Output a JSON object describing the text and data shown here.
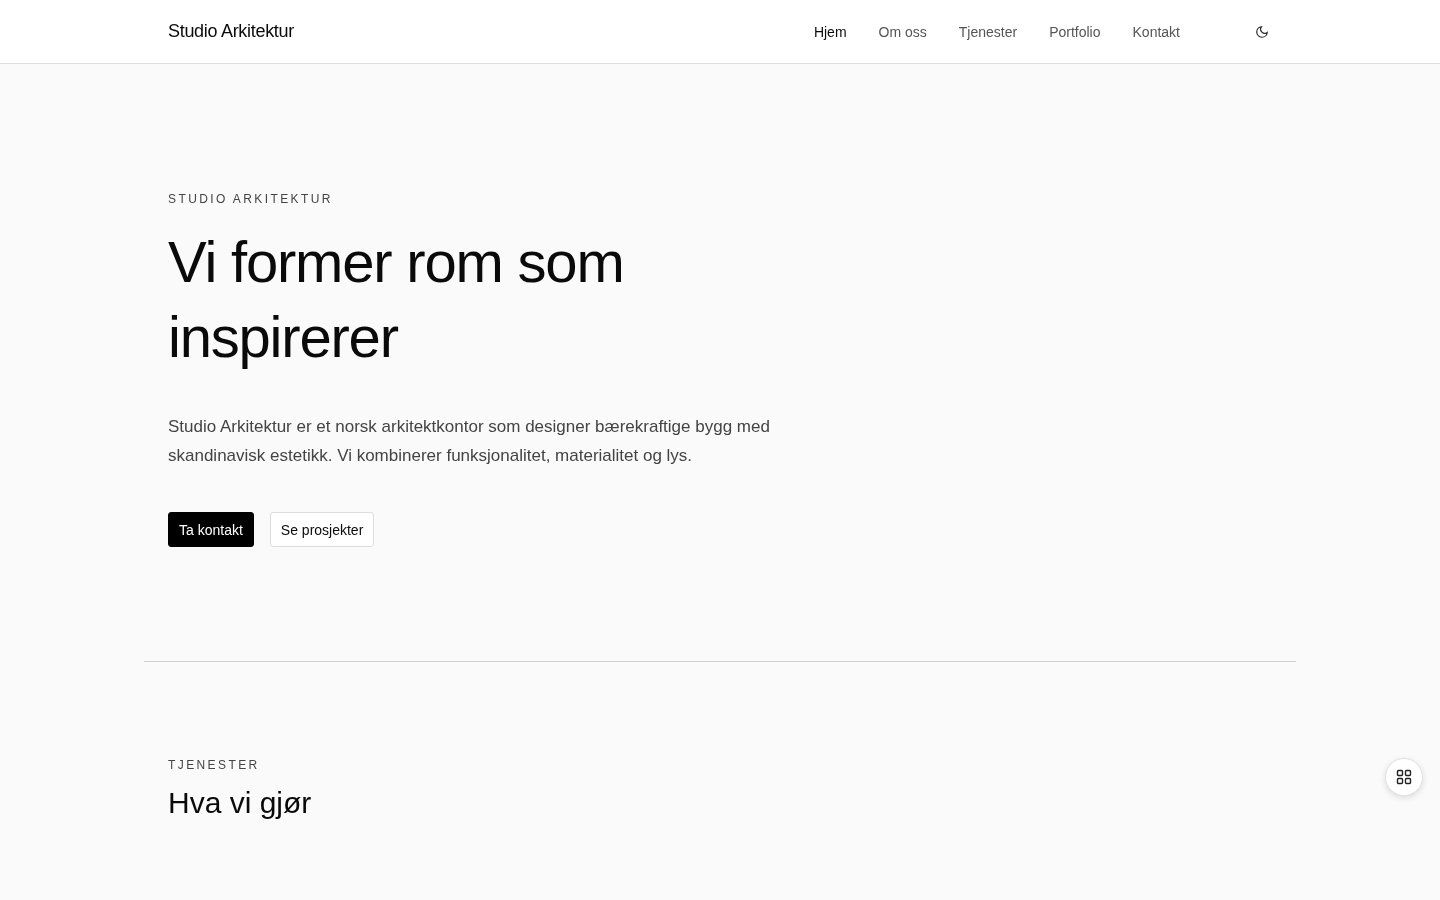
{
  "header": {
    "brand": "Studio Arkitektur",
    "nav": [
      {
        "label": "Hjem",
        "selected": true
      },
      {
        "label": "Om oss",
        "selected": false
      },
      {
        "label": "Tjenester",
        "selected": false
      },
      {
        "label": "Portfolio",
        "selected": false
      },
      {
        "label": "Kontakt",
        "selected": false
      }
    ]
  },
  "hero": {
    "eyebrow": "STUDIO ARKITEKTUR",
    "title": "Vi former rom som inspirerer",
    "lead": "Studio Arkitektur er et norsk arkitektkontor som designer bærekraftige bygg med skandinavisk estetikk. Vi kombinerer funksjonalitet, materialitet og lys.",
    "buttons": [
      {
        "label": "Ta kontakt",
        "kind": "primary"
      },
      {
        "label": "Se prosjekter",
        "kind": "secondary"
      }
    ]
  },
  "services": {
    "eyebrow": "TJENESTER",
    "title": "Hva vi gjør"
  }
}
